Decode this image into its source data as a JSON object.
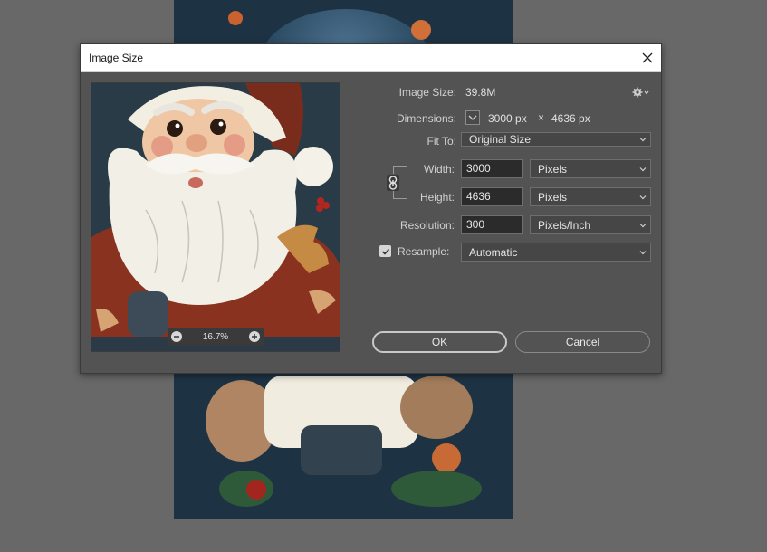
{
  "dialog": {
    "title": "Image Size",
    "image_size_label": "Image Size:",
    "image_size_value": "39.8M",
    "dimensions_label": "Dimensions:",
    "dimensions_width": "3000 px",
    "dimensions_separator": "×",
    "dimensions_height": "4636 px",
    "fit_to_label": "Fit To:",
    "fit_to_value": "Original Size",
    "width_label": "Width:",
    "width_value": "3000",
    "width_unit": "Pixels",
    "height_label": "Height:",
    "height_value": "4636",
    "height_unit": "Pixels",
    "resolution_label": "Resolution:",
    "resolution_value": "300",
    "resolution_unit": "Pixels/Inch",
    "resample_label": "Resample:",
    "resample_checked": true,
    "resample_value": "Automatic",
    "ok_label": "OK",
    "cancel_label": "Cancel"
  },
  "preview": {
    "zoom_text": "16.7%"
  },
  "icons": [
    "close-icon",
    "gear-icon",
    "chevron-down-icon",
    "link-icon",
    "zoom-out-icon",
    "zoom-in-icon",
    "checkmark-icon"
  ]
}
